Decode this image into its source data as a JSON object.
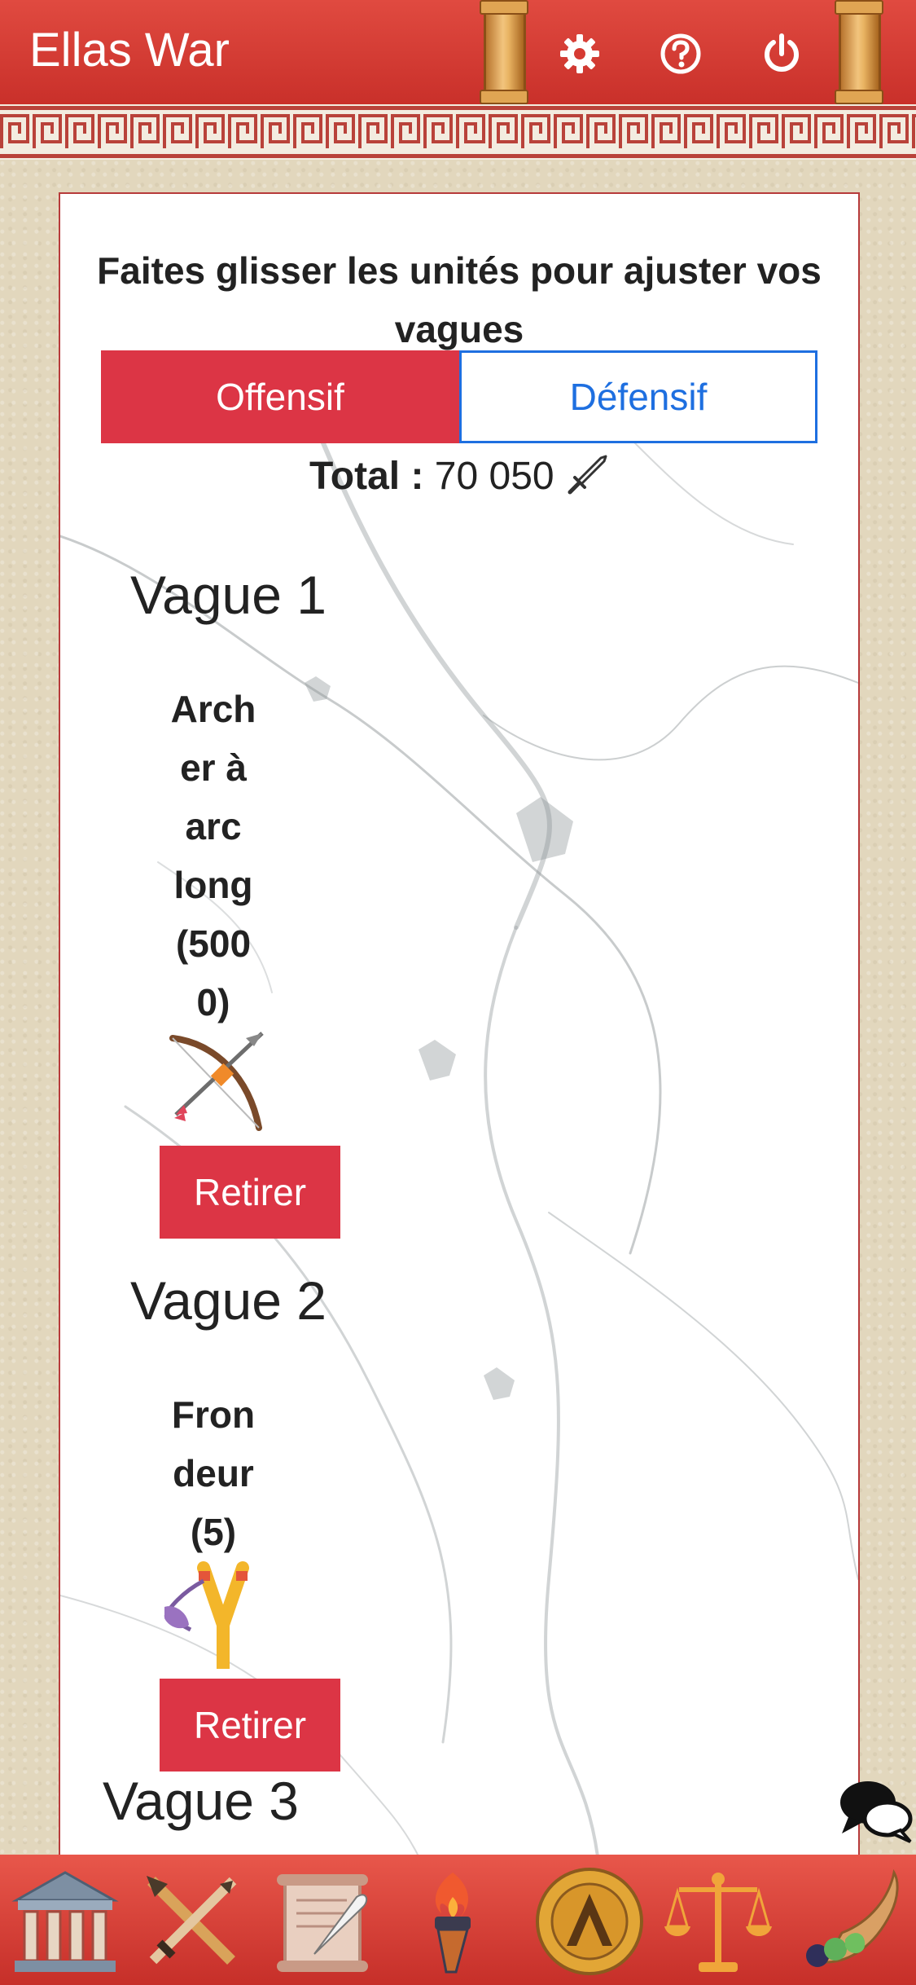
{
  "header": {
    "app_title": "Ellas War"
  },
  "card": {
    "instruction": "Faites glisser les unités pour ajuster vos vagues",
    "tabs": {
      "offensive": "Offensif",
      "defensive": "Défensif",
      "active": "offensive"
    },
    "total": {
      "label": "Total :",
      "value": "70 050"
    },
    "waves": [
      {
        "title": "Vague 1",
        "unit_lines": [
          "Arch",
          "er à",
          "arc",
          "long",
          "(500",
          "0)"
        ],
        "remove_label": "Retirer",
        "unit_icon": "bow-icon"
      },
      {
        "title": "Vague 2",
        "unit_lines": [
          "Fron",
          "deur",
          "(5)"
        ],
        "remove_label": "Retirer",
        "unit_icon": "slingshot-icon"
      },
      {
        "title": "Vague 3"
      }
    ]
  },
  "bottom_nav": [
    "temple-icon",
    "crossed-swords-icon",
    "scroll-icon",
    "torch-icon",
    "spartan-shield-icon",
    "scales-icon",
    "cornucopia-icon"
  ],
  "colors": {
    "header_red": "#d63a32",
    "button_red": "#dc3545",
    "link_blue": "#1e6fe0",
    "parchment": "#e2d7bd"
  }
}
